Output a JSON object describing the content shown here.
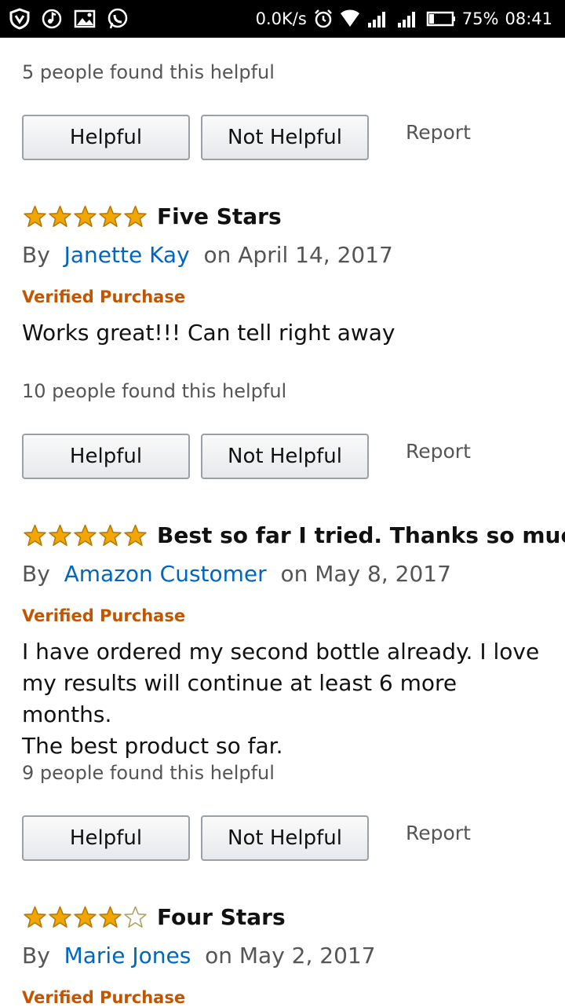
{
  "status_bar": {
    "net_speed": "0.0K/s",
    "battery": "75%",
    "time": "08:41",
    "icons": [
      "vpn-shield-icon",
      "music-icon",
      "image-icon",
      "whatsapp-icon",
      "alarm-icon",
      "wifi-icon",
      "signal-icon",
      "signal-icon",
      "battery-icon"
    ]
  },
  "colors": {
    "star": "#f0a800",
    "author_link": "#0066c0",
    "verified": "#c45500"
  },
  "top": {
    "helpful_text": "5 people found this helpful",
    "helpful_label": "Helpful",
    "not_helpful_label": "Not Helpful",
    "report_label": "Report"
  },
  "reviews": [
    {
      "rating": 5,
      "title": "Five Stars",
      "by": "By",
      "author": "Janette Kay",
      "date": "on April 14, 2017",
      "verified": "Verified Purchase",
      "body": "Works great!!! Can tell right away",
      "helpful_text": "10 people found this helpful",
      "helpful_label": "Helpful",
      "not_helpful_label": "Not Helpful",
      "report_label": "Report"
    },
    {
      "rating": 5,
      "title": "Best so far I tried. Thanks so much",
      "by": "By",
      "author": "Amazon Customer",
      "date": "on May 8, 2017",
      "verified": "Verified Purchase",
      "body_lines": [
        "I have ordered my second bottle already. I love",
        "my results will continue at least 6 more months.",
        "The best product so far."
      ],
      "helpful_text": "9 people found this helpful",
      "helpful_label": "Helpful",
      "not_helpful_label": "Not Helpful",
      "report_label": "Report"
    },
    {
      "rating": 4,
      "title": "Four Stars",
      "by": "By",
      "author": "Marie Jones",
      "date": "on May 2, 2017",
      "verified": "Verified Purchase"
    }
  ]
}
